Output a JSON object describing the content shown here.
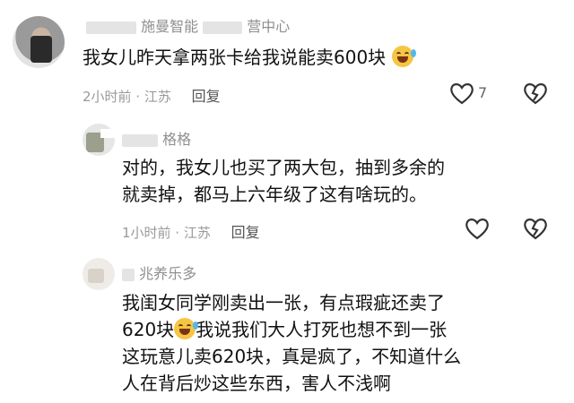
{
  "comments": [
    {
      "name_prefix": "",
      "name_visible": "施曼智能",
      "name_suffix": "营中心",
      "text": "我女儿昨天拿两张卡给我说能卖600块",
      "time": "2小时前 · 江苏",
      "reply_label": "回复",
      "like_count": "7"
    },
    {
      "name_visible": "格格",
      "text_lines": [
        "对的，我女儿也买了两大包，抽到多余的",
        "就卖掉，都马上六年级了这有啥玩的。"
      ],
      "time": "1小时前 · 江苏",
      "reply_label": "回复"
    },
    {
      "name_visible": "兆养乐多",
      "text_lines": [
        "我闺女同学刚卖出一张，有点瑕疵还卖了",
        "620块",
        "我说我们大人打死也想不到一张",
        "这玩意儿卖620块，真是疯了，不知道什么",
        "人在背后炒这些东西，害人不浅啊"
      ]
    }
  ],
  "icons": {
    "like": "heart-outline-icon",
    "dislike": "broken-heart-icon",
    "emoji": "rolling-on-floor-laughing-emoji"
  },
  "colors": {
    "text": "#111111",
    "meta": "#9a9a9a",
    "name": "#8f8f8f"
  }
}
